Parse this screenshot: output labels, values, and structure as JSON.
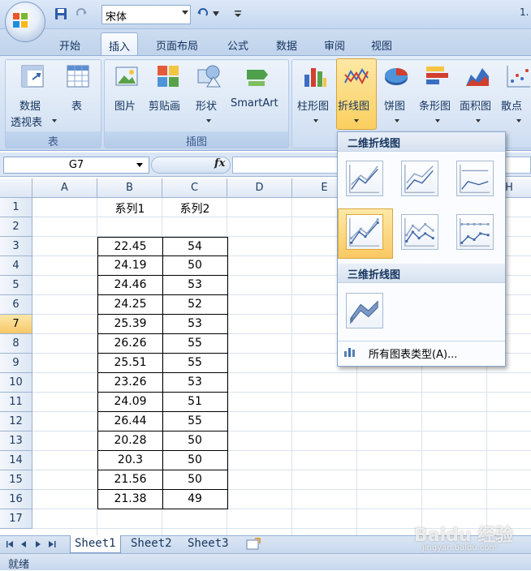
{
  "quick_access": {
    "font_name": "宋体",
    "title_fragment": "1."
  },
  "tabs": [
    "开始",
    "插入",
    "页面布局",
    "公式",
    "数据",
    "审阅",
    "视图"
  ],
  "active_tab": "插入",
  "ribbon": {
    "group_table": {
      "label": "表",
      "buttons": [
        {
          "label1": "数据",
          "label2": "透视表"
        },
        {
          "label": "表"
        }
      ]
    },
    "group_illus": {
      "label": "插图",
      "buttons": [
        {
          "label": "图片"
        },
        {
          "label": "剪贴画"
        },
        {
          "label": "形状"
        },
        {
          "label": "SmartArt"
        }
      ]
    },
    "group_chart": {
      "buttons": [
        {
          "label": "柱形图"
        },
        {
          "label": "折线图"
        },
        {
          "label": "饼图"
        },
        {
          "label": "条形图"
        },
        {
          "label": "面积图"
        },
        {
          "label": "散点"
        }
      ]
    }
  },
  "formula_bar": {
    "name_box": "G7",
    "fx": "fx",
    "value": ""
  },
  "columns": [
    "A",
    "B",
    "C",
    "D",
    "E",
    "H"
  ],
  "rows": [
    "1",
    "2",
    "3",
    "4",
    "5",
    "6",
    "7",
    "8",
    "9",
    "10",
    "11",
    "12",
    "13",
    "14",
    "15",
    "16",
    "17"
  ],
  "selected_row": "7",
  "headers": {
    "b": "系列1",
    "c": "系列2"
  },
  "data": [
    {
      "b": "22.45",
      "c": "54"
    },
    {
      "b": "24.19",
      "c": "50"
    },
    {
      "b": "24.46",
      "c": "53"
    },
    {
      "b": "24.25",
      "c": "52"
    },
    {
      "b": "25.39",
      "c": "53"
    },
    {
      "b": "26.26",
      "c": "55"
    },
    {
      "b": "25.51",
      "c": "55"
    },
    {
      "b": "23.26",
      "c": "53"
    },
    {
      "b": "24.09",
      "c": "51"
    },
    {
      "b": "26.44",
      "c": "55"
    },
    {
      "b": "20.28",
      "c": "50"
    },
    {
      "b": "20.3",
      "c": "50"
    },
    {
      "b": "21.56",
      "c": "50"
    },
    {
      "b": "21.38",
      "c": "49"
    }
  ],
  "gallery": {
    "header_2d": "二维折线图",
    "header_3d": "三维折线图",
    "all_types": "所有图表类型(A)..."
  },
  "sheets": [
    "Sheet1",
    "Sheet2",
    "Sheet3"
  ],
  "status": "就绪",
  "watermark": {
    "main": "Baidu 经验",
    "sub": "jingyan.baidu.com"
  }
}
